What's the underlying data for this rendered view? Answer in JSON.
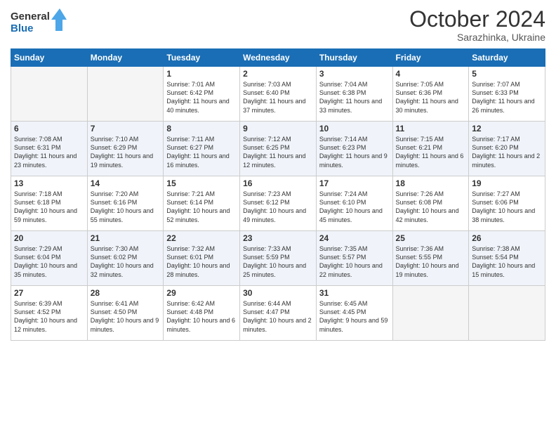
{
  "header": {
    "logo_line1": "General",
    "logo_line2": "Blue",
    "month": "October 2024",
    "location": "Sarazhinka, Ukraine"
  },
  "weekdays": [
    "Sunday",
    "Monday",
    "Tuesday",
    "Wednesday",
    "Thursday",
    "Friday",
    "Saturday"
  ],
  "rows": [
    [
      {
        "day": "",
        "content": ""
      },
      {
        "day": "",
        "content": ""
      },
      {
        "day": "1",
        "content": "Sunrise: 7:01 AM\nSunset: 6:42 PM\nDaylight: 11 hours and 40 minutes."
      },
      {
        "day": "2",
        "content": "Sunrise: 7:03 AM\nSunset: 6:40 PM\nDaylight: 11 hours and 37 minutes."
      },
      {
        "day": "3",
        "content": "Sunrise: 7:04 AM\nSunset: 6:38 PM\nDaylight: 11 hours and 33 minutes."
      },
      {
        "day": "4",
        "content": "Sunrise: 7:05 AM\nSunset: 6:36 PM\nDaylight: 11 hours and 30 minutes."
      },
      {
        "day": "5",
        "content": "Sunrise: 7:07 AM\nSunset: 6:33 PM\nDaylight: 11 hours and 26 minutes."
      }
    ],
    [
      {
        "day": "6",
        "content": "Sunrise: 7:08 AM\nSunset: 6:31 PM\nDaylight: 11 hours and 23 minutes."
      },
      {
        "day": "7",
        "content": "Sunrise: 7:10 AM\nSunset: 6:29 PM\nDaylight: 11 hours and 19 minutes."
      },
      {
        "day": "8",
        "content": "Sunrise: 7:11 AM\nSunset: 6:27 PM\nDaylight: 11 hours and 16 minutes."
      },
      {
        "day": "9",
        "content": "Sunrise: 7:12 AM\nSunset: 6:25 PM\nDaylight: 11 hours and 12 minutes."
      },
      {
        "day": "10",
        "content": "Sunrise: 7:14 AM\nSunset: 6:23 PM\nDaylight: 11 hours and 9 minutes."
      },
      {
        "day": "11",
        "content": "Sunrise: 7:15 AM\nSunset: 6:21 PM\nDaylight: 11 hours and 6 minutes."
      },
      {
        "day": "12",
        "content": "Sunrise: 7:17 AM\nSunset: 6:20 PM\nDaylight: 11 hours and 2 minutes."
      }
    ],
    [
      {
        "day": "13",
        "content": "Sunrise: 7:18 AM\nSunset: 6:18 PM\nDaylight: 10 hours and 59 minutes."
      },
      {
        "day": "14",
        "content": "Sunrise: 7:20 AM\nSunset: 6:16 PM\nDaylight: 10 hours and 55 minutes."
      },
      {
        "day": "15",
        "content": "Sunrise: 7:21 AM\nSunset: 6:14 PM\nDaylight: 10 hours and 52 minutes."
      },
      {
        "day": "16",
        "content": "Sunrise: 7:23 AM\nSunset: 6:12 PM\nDaylight: 10 hours and 49 minutes."
      },
      {
        "day": "17",
        "content": "Sunrise: 7:24 AM\nSunset: 6:10 PM\nDaylight: 10 hours and 45 minutes."
      },
      {
        "day": "18",
        "content": "Sunrise: 7:26 AM\nSunset: 6:08 PM\nDaylight: 10 hours and 42 minutes."
      },
      {
        "day": "19",
        "content": "Sunrise: 7:27 AM\nSunset: 6:06 PM\nDaylight: 10 hours and 38 minutes."
      }
    ],
    [
      {
        "day": "20",
        "content": "Sunrise: 7:29 AM\nSunset: 6:04 PM\nDaylight: 10 hours and 35 minutes."
      },
      {
        "day": "21",
        "content": "Sunrise: 7:30 AM\nSunset: 6:02 PM\nDaylight: 10 hours and 32 minutes."
      },
      {
        "day": "22",
        "content": "Sunrise: 7:32 AM\nSunset: 6:01 PM\nDaylight: 10 hours and 28 minutes."
      },
      {
        "day": "23",
        "content": "Sunrise: 7:33 AM\nSunset: 5:59 PM\nDaylight: 10 hours and 25 minutes."
      },
      {
        "day": "24",
        "content": "Sunrise: 7:35 AM\nSunset: 5:57 PM\nDaylight: 10 hours and 22 minutes."
      },
      {
        "day": "25",
        "content": "Sunrise: 7:36 AM\nSunset: 5:55 PM\nDaylight: 10 hours and 19 minutes."
      },
      {
        "day": "26",
        "content": "Sunrise: 7:38 AM\nSunset: 5:54 PM\nDaylight: 10 hours and 15 minutes."
      }
    ],
    [
      {
        "day": "27",
        "content": "Sunrise: 6:39 AM\nSunset: 4:52 PM\nDaylight: 10 hours and 12 minutes."
      },
      {
        "day": "28",
        "content": "Sunrise: 6:41 AM\nSunset: 4:50 PM\nDaylight: 10 hours and 9 minutes."
      },
      {
        "day": "29",
        "content": "Sunrise: 6:42 AM\nSunset: 4:48 PM\nDaylight: 10 hours and 6 minutes."
      },
      {
        "day": "30",
        "content": "Sunrise: 6:44 AM\nSunset: 4:47 PM\nDaylight: 10 hours and 2 minutes."
      },
      {
        "day": "31",
        "content": "Sunrise: 6:45 AM\nSunset: 4:45 PM\nDaylight: 9 hours and 59 minutes."
      },
      {
        "day": "",
        "content": ""
      },
      {
        "day": "",
        "content": ""
      }
    ]
  ]
}
